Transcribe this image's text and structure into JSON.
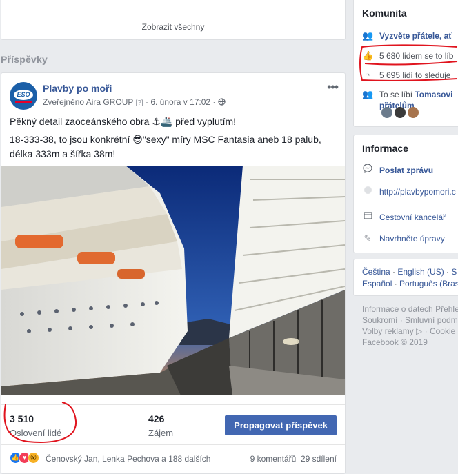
{
  "top_card": {
    "show_all": "Zobrazit všechny"
  },
  "section_title": "Příspěvky",
  "post": {
    "page_name": "Plavby po moři",
    "avatar_text": "ESO",
    "published_label": "Zveřejněno",
    "author": "Aira GROUP",
    "help_mark": "[?]",
    "date": "6. února v 17:02",
    "text_line1": "Pěkný detail zaoceánského obra ⚓🚢 před vyplutím!",
    "text_line2": "18-333-38, to jsou konkrétní 😎\"sexy\" míry MSC Fantasia aneb 18 palub, délka 333m a šířka 38m!",
    "stat1_number": "3 510",
    "stat1_label": "Oslovení lidé",
    "stat2_number": "426",
    "stat2_label": "Zájem",
    "promote_button": "Propagovat příspěvek",
    "reactions_names": "Čenovský Jan, Lenka Pechova a 188 dalších",
    "comments": "9 komentářů",
    "shares": "29 sdílení"
  },
  "komunita": {
    "title": "Komunita",
    "invite": "Vyzvěte přátele, ať",
    "likes": "5 680 lidem se to líb",
    "follows": "5 695 lidí to sleduje",
    "friends_like_prefix": "To se líbí ",
    "friends_like_name": "Tomasovi",
    "friends_like_suffix": "přátelům"
  },
  "informace": {
    "title": "Informace",
    "message": "Poslat zprávu",
    "website": "http://plavbypomori.c",
    "category": "Cestovní kancelář",
    "suggest": "Navrhněte úpravy"
  },
  "languages": {
    "line1_a": "Čeština",
    "line1_b": "English (US)",
    "line1_c": "S",
    "line2_a": "Español",
    "line2_b": "Português (Bras"
  },
  "footer": {
    "line1": "Informace o datech",
    "line1_b": "Přehle",
    "line2_a": "Soukromí",
    "line2_b": "Smluvní podm",
    "line3_a": "Volby reklamy",
    "line3_b": "Cookie",
    "copyright": "Facebook © 2019"
  },
  "colors": {
    "brand_blue": "#4267b2",
    "link_blue": "#385898",
    "annotation_red": "#e0141e"
  }
}
